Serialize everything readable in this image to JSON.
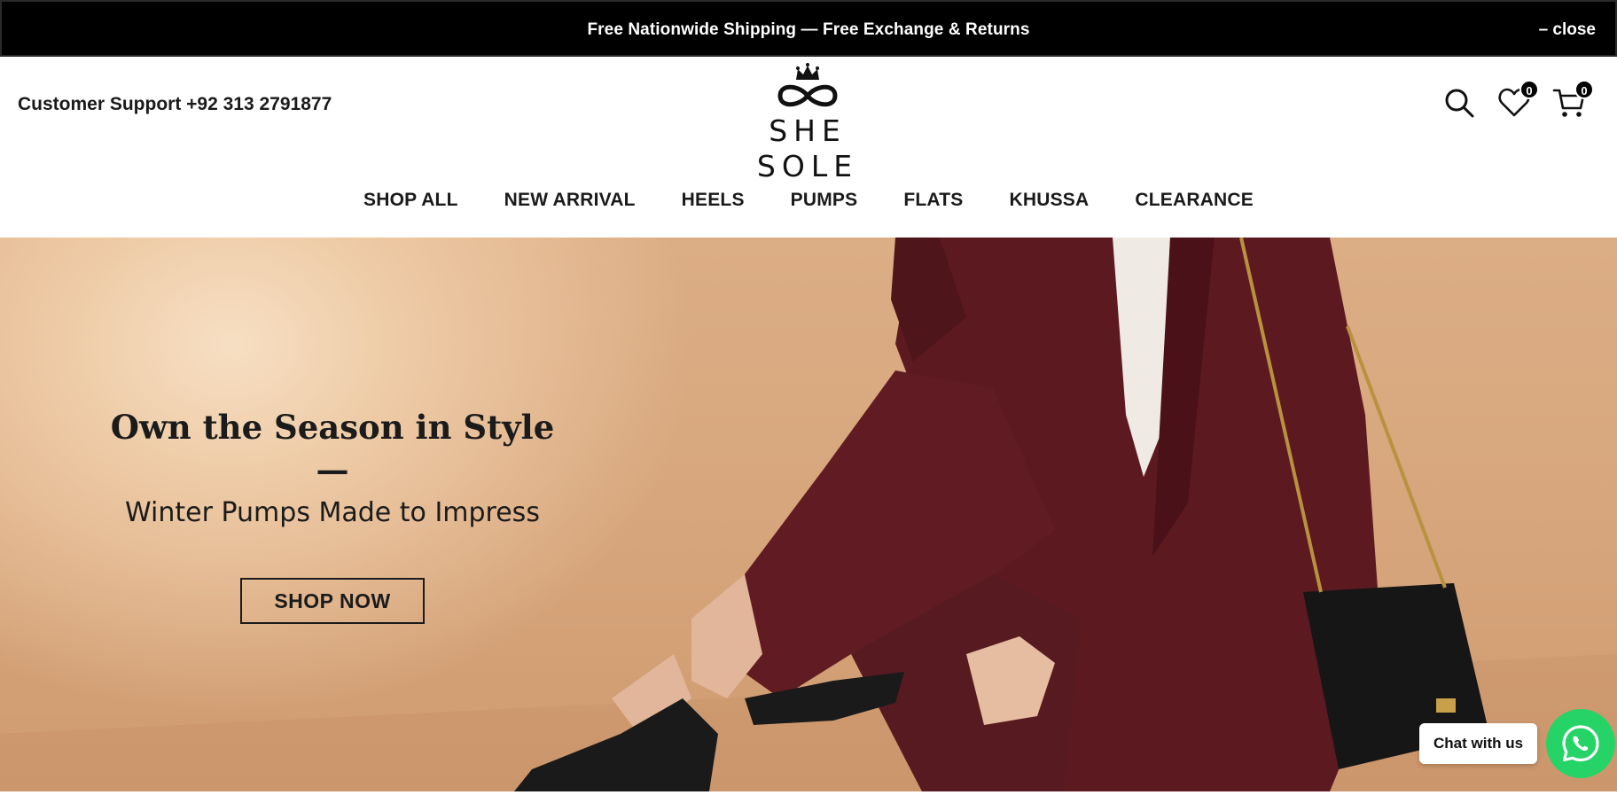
{
  "announcement": {
    "message": "Free Nationwide Shipping — Free Exchange & Returns",
    "close_label": "– close"
  },
  "header": {
    "support_text": "Customer Support +92 313 2791877",
    "logo_text": "SHE SOLE",
    "wishlist_count": "0",
    "cart_count": "0"
  },
  "nav": {
    "items": [
      "SHOP ALL",
      "NEW ARRIVAL",
      "HEELS",
      "PUMPS",
      "FLATS",
      "KHUSSA",
      "CLEARANCE"
    ]
  },
  "hero": {
    "title": "Own the Season in Style —",
    "subtitle": "Winter Pumps Made to Impress",
    "cta_label": "SHOP NOW"
  },
  "chat": {
    "label": "Chat with us",
    "color": "#25d366"
  },
  "icons": [
    "search-icon",
    "heart-icon",
    "cart-icon",
    "whatsapp-icon",
    "crown-icon",
    "infinity-icon"
  ]
}
